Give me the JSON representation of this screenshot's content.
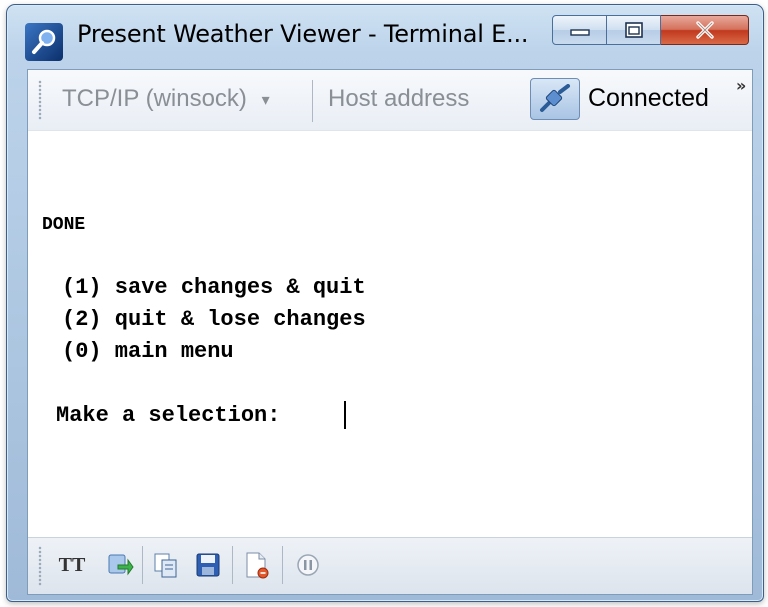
{
  "window": {
    "title": "Present Weather Viewer - Terminal E...",
    "colors": {
      "frame": "#9fbad8",
      "close": "#c0381e"
    }
  },
  "toolbar": {
    "protocol_label": "TCP/IP (winsock)",
    "protocol_arrow": "▾",
    "host_placeholder": "Host address",
    "status": "Connected",
    "overflow": "»"
  },
  "terminal": {
    "heading": "DONE",
    "options": [
      "(1) save changes & quit",
      "(2) quit & lose changes",
      "(0) main menu"
    ],
    "prompt": "Make a selection:"
  },
  "bottom_toolbar": {
    "font_button": "TT",
    "icons": [
      "font-size-icon",
      "transfer-icon",
      "copy-icon",
      "save-icon",
      "new-document-icon",
      "pause-icon"
    ]
  }
}
